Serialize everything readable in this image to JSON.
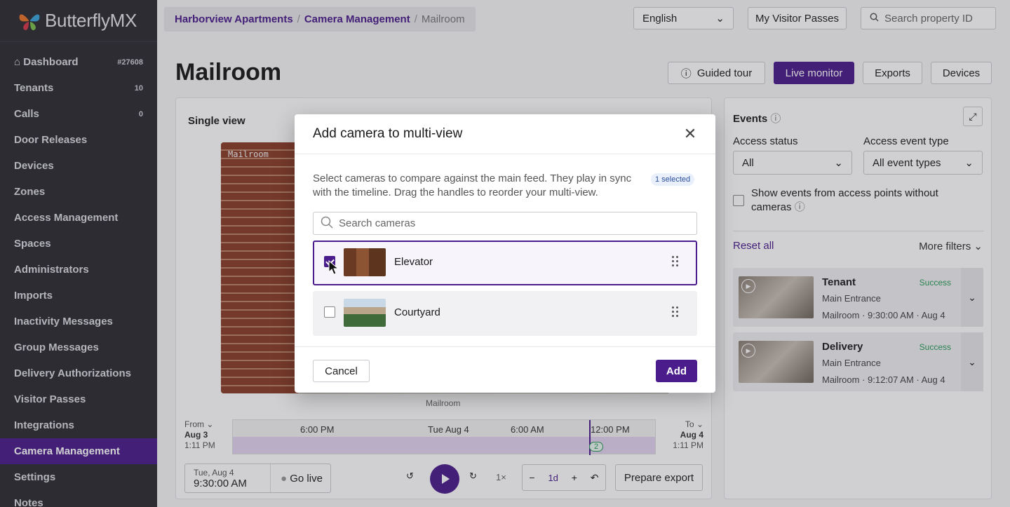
{
  "brand": {
    "name": "ButterflyMX"
  },
  "sidebar": {
    "items": [
      {
        "label": "Dashboard",
        "count": "#27608"
      },
      {
        "label": "Tenants",
        "count": "10"
      },
      {
        "label": "Calls",
        "count": "0"
      },
      {
        "label": "Door Releases",
        "count": ""
      },
      {
        "label": "Devices",
        "count": ""
      },
      {
        "label": "Zones",
        "count": ""
      },
      {
        "label": "Access Management",
        "count": ""
      },
      {
        "label": "Spaces",
        "count": ""
      },
      {
        "label": "Administrators",
        "count": ""
      },
      {
        "label": "Imports",
        "count": ""
      },
      {
        "label": "Inactivity Messages",
        "count": ""
      },
      {
        "label": "Group Messages",
        "count": ""
      },
      {
        "label": "Delivery Authorizations",
        "count": ""
      },
      {
        "label": "Visitor Passes",
        "count": ""
      },
      {
        "label": "Integrations",
        "count": ""
      },
      {
        "label": "Camera Management",
        "count": ""
      },
      {
        "label": "Settings",
        "count": ""
      },
      {
        "label": "Notes",
        "count": ""
      }
    ]
  },
  "header": {
    "breadcrumb": [
      "Harborview Apartments",
      "Camera Management",
      "Mailroom"
    ],
    "language": "English",
    "visitor_passes": "My Visitor Passes",
    "search_placeholder": "Search property ID"
  },
  "page": {
    "title": "Mailroom",
    "buttons": {
      "tour": "Guided tour",
      "live": "Live monitor",
      "exports": "Exports",
      "devices": "Devices"
    }
  },
  "single_view": {
    "label": "Single view",
    "camera_label": "Mailroom",
    "caption": "Mailroom",
    "ticks": [
      "6:00 PM",
      "Tue Aug 4",
      "6:00 AM",
      "12:00 PM"
    ],
    "from": {
      "label": "From",
      "date": "Aug 3",
      "time": "1:11 PM"
    },
    "to": {
      "label": "To",
      "date": "Aug 4",
      "time": "1:11 PM"
    },
    "marker_count": "2",
    "datetime": {
      "date": "Tue, Aug 4",
      "time": "9:30:00 AM"
    },
    "go_live": "Go live",
    "speed": "1×",
    "range": "1d",
    "prepare_export": "Prepare export"
  },
  "events": {
    "title": "Events",
    "access_status_label": "Access status",
    "access_status_value": "All",
    "event_type_label": "Access event type",
    "event_type_value": "All event types",
    "show_events_label": "Show events from access points without cameras",
    "reset": "Reset all",
    "more_filters": "More filters",
    "items": [
      {
        "name": "Tenant",
        "status": "Success",
        "location": "Main Entrance",
        "detail": "Mailroom · 9:30:00 AM · Aug 4"
      },
      {
        "name": "Delivery",
        "status": "Success",
        "location": "Main Entrance",
        "detail": "Mailroom · 9:12:07 AM · Aug 4"
      }
    ]
  },
  "modal": {
    "title": "Add camera to multi-view",
    "description": "Select cameras to compare against the main feed. They play in sync with the timeline. Drag the handles to reorder your multi-view.",
    "selected_badge": "1 selected",
    "search_placeholder": "Search cameras",
    "cameras": [
      {
        "name": "Elevator",
        "checked": true
      },
      {
        "name": "Courtyard",
        "checked": false
      }
    ],
    "cancel": "Cancel",
    "add": "Add"
  }
}
